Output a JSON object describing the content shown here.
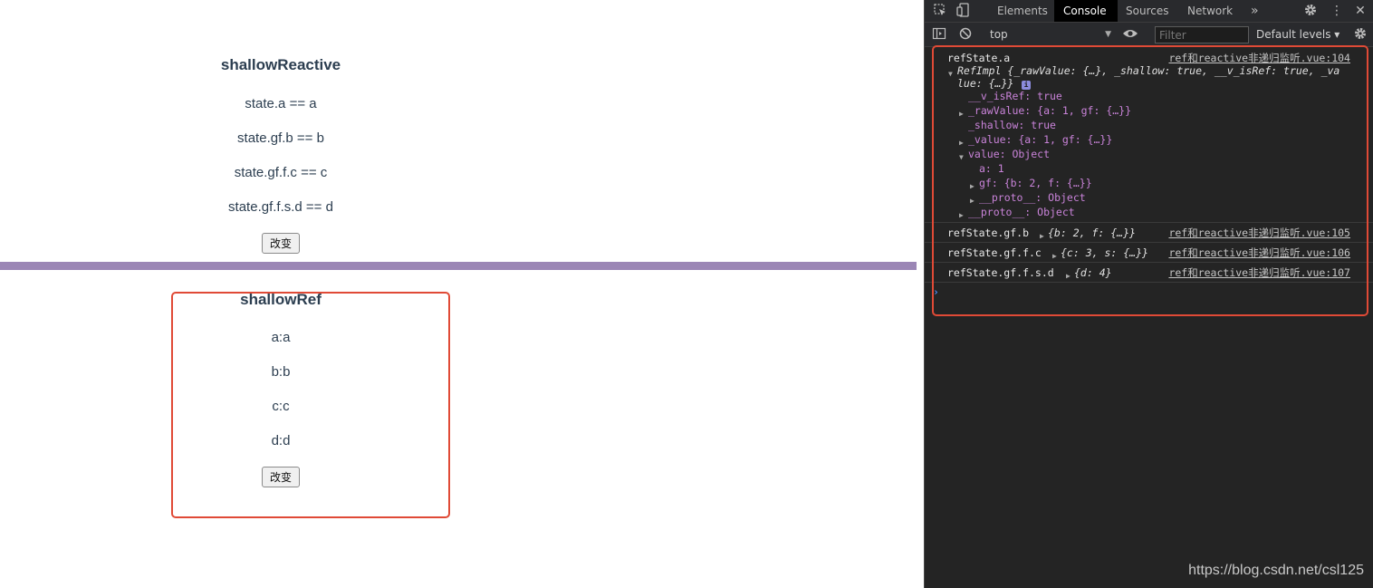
{
  "page": {
    "shallow_reactive": {
      "title": "shallowReactive",
      "lines": [
        "state.a == a",
        "state.gf.b == b",
        "state.gf.f.c == c",
        "state.gf.f.s.d == d"
      ],
      "button": "改变"
    },
    "shallow_ref": {
      "title": "shallowRef",
      "lines": [
        "a:a",
        "b:b",
        "c:c",
        "d:d"
      ],
      "button": "改变"
    }
  },
  "devtools": {
    "tabs": [
      "Elements",
      "Console",
      "Sources",
      "Network",
      "»"
    ],
    "active_tab": "Console",
    "context": "top",
    "filter_placeholder": "Filter",
    "levels": "Default levels ▾",
    "logs": [
      {
        "label": "refState.a",
        "source": "ref和reactive非递归监听.vue:104",
        "summary_line1": "RefImpl {_rawValue: {…}, _shallow: true, __v_isRef: true, _va",
        "summary_line2": "lue: {…}}",
        "props": [
          {
            "text": "__v_isRef: true"
          },
          {
            "text": "_rawValue: {a: 1, gf: {…}}"
          },
          {
            "text": "_shallow: true"
          },
          {
            "text": "_value: {a: 1, gf: {…}}"
          },
          {
            "text": "value: Object"
          },
          {
            "text": "a: 1"
          },
          {
            "text": "gf: {b: 2, f: {…}}"
          },
          {
            "text": "__proto__: Object"
          },
          {
            "text": "__proto__: Object"
          }
        ]
      },
      {
        "label": "refState.gf.b",
        "value": "{b: 2, f: {…}}",
        "source": "ref和reactive非递归监听.vue:105"
      },
      {
        "label": "refState.gf.f.c",
        "value": "{c: 3, s: {…}}",
        "source": "ref和reactive非递归监听.vue:106"
      },
      {
        "label": "refState.gf.f.s.d",
        "value": "{d: 4}",
        "source": "ref和reactive非递归监听.vue:107"
      }
    ],
    "prompt": "›"
  },
  "watermark": "https://blog.csdn.net/csl125"
}
